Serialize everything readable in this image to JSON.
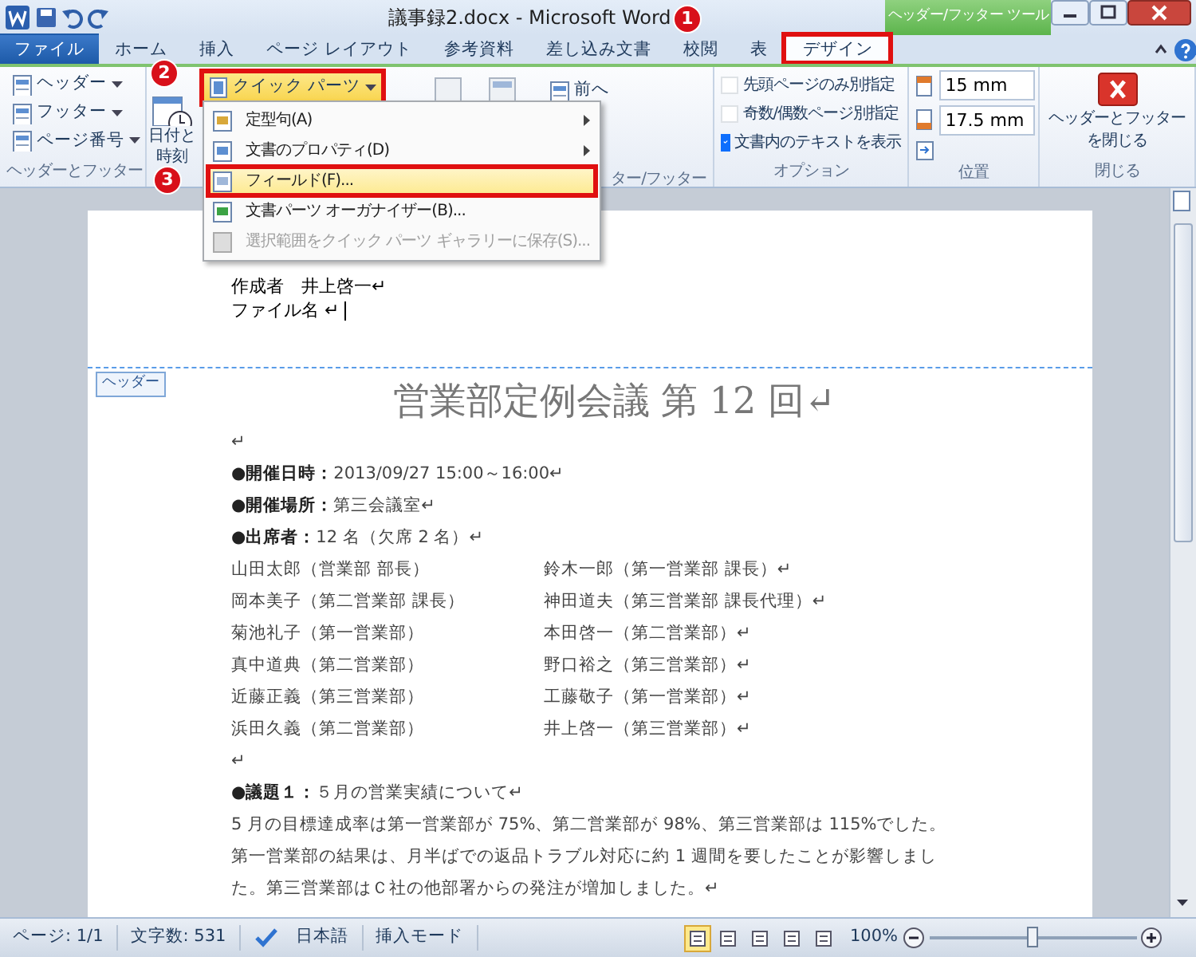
{
  "window": {
    "title": "議事録2.docx - Microsoft Word",
    "context_group": "ヘッダー/フッター ツール"
  },
  "tabs": [
    {
      "label": "ファイル",
      "kind": "file",
      "selected": false,
      "highlighted": false
    },
    {
      "label": "ホーム",
      "kind": "normal",
      "selected": false,
      "highlighted": false
    },
    {
      "label": "挿入",
      "kind": "normal",
      "selected": false,
      "highlighted": false
    },
    {
      "label": "ページ レイアウト",
      "kind": "normal",
      "selected": false,
      "highlighted": false
    },
    {
      "label": "参考資料",
      "kind": "normal",
      "selected": false,
      "highlighted": false
    },
    {
      "label": "差し込み文書",
      "kind": "normal",
      "selected": false,
      "highlighted": false
    },
    {
      "label": "校閲",
      "kind": "normal",
      "selected": false,
      "highlighted": false
    },
    {
      "label": "表",
      "kind": "normal",
      "selected": false,
      "highlighted": false
    },
    {
      "label": "デザイン",
      "kind": "context",
      "selected": true,
      "highlighted": true
    }
  ],
  "ribbon": {
    "header_footer": {
      "items": [
        "ヘッダー",
        "フッター",
        "ページ番号"
      ],
      "label": "ヘッダーとフッター"
    },
    "insert": {
      "date_time": [
        "日付と",
        "時刻"
      ],
      "quick_parts": {
        "label": "クイック パーツ",
        "highlighted": true
      },
      "previous": "前へ",
      "label": "ター/フッター"
    },
    "options": {
      "items": [
        {
          "label": "先頭ページのみ別指定",
          "checked": false
        },
        {
          "label": "奇数/偶数ページ別指定",
          "checked": false
        },
        {
          "label": "文書内のテキストを表示",
          "checked": true
        }
      ],
      "label": "オプション"
    },
    "position": {
      "fields": [
        "15 mm",
        "17.5 mm"
      ],
      "label": "位置"
    },
    "close": {
      "lines": [
        "ヘッダーとフッター",
        "を閉じる"
      ],
      "label": "閉じる"
    }
  },
  "menu": [
    {
      "label": "定型句(A)",
      "submenu": true,
      "disabled": false,
      "highlighted": false
    },
    {
      "label": "文書のプロパティ(D)",
      "submenu": true,
      "disabled": false,
      "highlighted": false
    },
    {
      "label": "フィールド(F)...",
      "submenu": false,
      "disabled": false,
      "highlighted": true
    },
    {
      "label": "文書パーツ オーガナイザー(B)...",
      "submenu": false,
      "disabled": false,
      "highlighted": false
    },
    {
      "label": "選択範囲をクイック パーツ ギャラリーに保存(S)...",
      "submenu": false,
      "disabled": true,
      "highlighted": false
    }
  ],
  "callouts": [
    "1",
    "2",
    "3"
  ],
  "document": {
    "header_lines": [
      "作成者　井上啓一↵",
      "ファイル名 ↵"
    ],
    "header_tag": "ヘッダー",
    "title": "営業部定例会議 第 12 回↵",
    "body": [
      {
        "kind": "line",
        "text": "↵"
      },
      {
        "kind": "line",
        "text": "**●開催日時：**2013/09/27 15:00～16:00↵"
      },
      {
        "kind": "line",
        "text": "**●開催場所：**第三会議室↵"
      },
      {
        "kind": "line",
        "text": "**●出席者：**12 名（欠席 2 名）↵"
      },
      {
        "kind": "pair",
        "left": "山田太郎（営業部 部長）",
        "right": "鈴木一郎（第一営業部 課長）↵"
      },
      {
        "kind": "pair",
        "left": "岡本美子（第二営業部 課長）",
        "right": "神田道夫（第三営業部 課長代理）↵"
      },
      {
        "kind": "pair",
        "left": "菊池礼子（第一営業部）",
        "right": "本田啓一（第二営業部）↵"
      },
      {
        "kind": "pair",
        "left": "真中道典（第二営業部）",
        "right": "野口裕之（第三営業部）↵"
      },
      {
        "kind": "pair",
        "left": "近藤正義（第三営業部）",
        "right": "工藤敬子（第一営業部）↵"
      },
      {
        "kind": "pair",
        "left": "浜田久義（第二営業部）",
        "right": "井上啓一（第三営業部）↵"
      },
      {
        "kind": "line",
        "text": "↵"
      },
      {
        "kind": "line",
        "text": "**●議題１：**５月の営業実績について↵"
      },
      {
        "kind": "line",
        "text": "5 月の目標達成率は第一営業部が 75%、第二営業部が 98%、第三営業部は 115%でした。"
      },
      {
        "kind": "line",
        "text": "第一営業部の結果は、月半ばでの返品トラブル対応に約 1 週間を要したことが影響しまし"
      },
      {
        "kind": "line",
        "text": "た。第三営業部はＣ社の他部署からの発注が増加しました。↵"
      }
    ]
  },
  "status_bar": {
    "page": "ページ: 1/1",
    "words": "文字数: 531",
    "language": "日本語",
    "mode": "挿入モード",
    "views": [
      {
        "selected": true
      },
      {
        "selected": false
      },
      {
        "selected": false
      },
      {
        "selected": false
      },
      {
        "selected": false
      }
    ],
    "zoom": "100%",
    "zoom_slider": {
      "level": 0.5
    }
  }
}
